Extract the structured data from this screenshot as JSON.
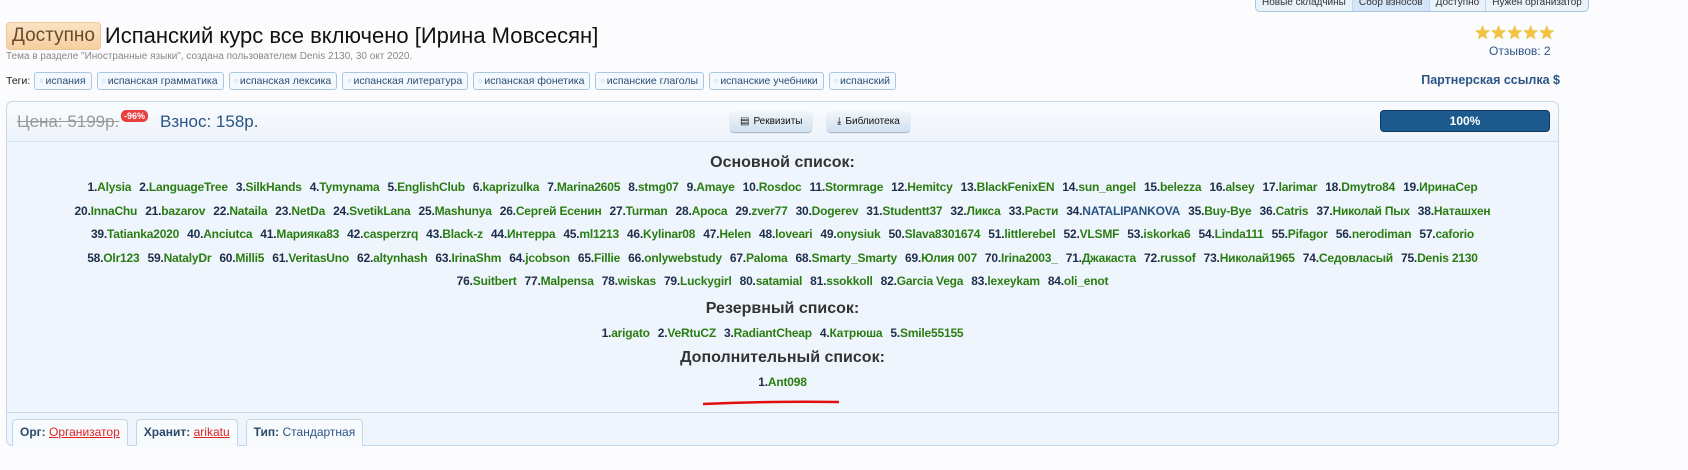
{
  "top_tabs": [
    "Новые складчины",
    "Сбор взносов",
    "Доступно",
    "Нужен организатор"
  ],
  "status_badge": "Доступно",
  "title": "Испанский курс все включено [Ирина Мовсесян]",
  "subtitle": "Тема в разделе \"Иностранные языки\", создана пользователем Denis 2130, 30 окт 2020.",
  "rating": {
    "stars": 5,
    "max": 5,
    "reviews_label": "Отзывов: 2"
  },
  "tags_label": "Теги:",
  "tags": [
    "испания",
    "испанская грамматика",
    "испанская лексика",
    "испанская литература",
    "испанская фонетика",
    "испанские глаголы",
    "испанские учебники",
    "испанский"
  ],
  "partner_link": "Партнерская ссылка $",
  "price": {
    "old": "Цена: 5199р.",
    "discount": "-96%",
    "fee": "Взнос: 158р."
  },
  "buttons": {
    "requisites": "Реквизиты",
    "library": "Библиотека"
  },
  "progress": {
    "value": 100,
    "label": "100%"
  },
  "main_list": {
    "title": "Основной список:",
    "rows": [
      [
        "Alysia",
        "LanguageTree",
        "SilkHands",
        "Tymynama",
        "EnglishClub",
        "kaprizulka",
        "Marina2605",
        "stmg07",
        "Amaye",
        "Rosdoc",
        "Stormrage",
        "Hemitcy",
        "BlackFenixEN",
        "sun_angel",
        "belezza",
        "alsey",
        "larimar",
        "Dmytro84",
        "ИринаСер"
      ],
      [
        "InnaChu",
        "bazarov",
        "Nataila",
        "NetDa",
        "SvetikLana",
        "Mashunya",
        "Сергей Есенин",
        "Turman",
        "Apoca",
        "zver77",
        "Dogerev",
        "Studentt37",
        "Ликса",
        "Расти",
        "NATALIPANKOVA",
        "Buy-Bye",
        "Catris",
        "Николай Пых",
        "Наташхен"
      ],
      [
        "Tatianka2020",
        "Anciutca",
        "Марияка83",
        "casperzrq",
        "Black-z",
        "Интерра",
        "ml1213",
        "Kylinar08",
        "Helen",
        "loveari",
        "onysiuk",
        "Slava8301674",
        "littlerebel",
        "VLSMF",
        "iskorka6",
        "Linda111",
        "Pifagor",
        "nerodiman",
        "caforio"
      ],
      [
        "Olr123",
        "NatalyDr",
        "Milli5",
        "VeritasUno",
        "altynhash",
        "IrinaShm",
        "jcobson",
        "Fillie",
        "onlywebstudy",
        "Paloma",
        "Smarty_Smarty",
        "Юлия 007",
        "Irina2003_",
        "Джакаста",
        "russof",
        "Николай1965",
        "Седовласый",
        "Denis 2130"
      ],
      [
        "Suitbert",
        "Malpensa",
        "wiskas",
        "Luckygirl",
        "satamial",
        "ssokkoll",
        "Garcia Vega",
        "lexeykam",
        "oli_enot"
      ]
    ]
  },
  "reserve_list": {
    "title": "Резервный список:",
    "rows": [
      [
        "arigato",
        "VeRtuCZ",
        "RadiantCheap",
        "Катрюша",
        "Smile55155"
      ]
    ]
  },
  "extra_list": {
    "title": "Дополнительный список:",
    "rows": [
      [
        "Ant098"
      ]
    ]
  },
  "bottom_tabs": {
    "org_label": "Орг:",
    "org_value": "Организатор",
    "keeper_label": "Хранит:",
    "keeper_value": "arikatu",
    "type_label": "Тип:",
    "type_value": "Стандартная"
  },
  "colors": {
    "accent": "#1c5a8d",
    "name_green": "#2a7d12",
    "link_blue": "#2a5585"
  }
}
